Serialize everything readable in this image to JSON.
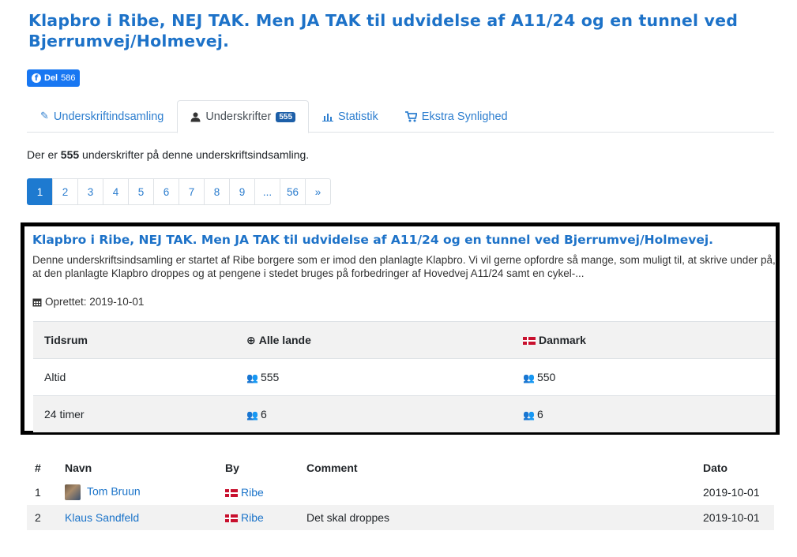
{
  "title": "Klapbro i Ribe, NEJ TAK. Men JA TAK til udvidelse af A11/24 og en tunnel ved Bjerrumvej/Holmevej.",
  "share": {
    "icon": "facebook-icon",
    "label": "Del",
    "count": "586"
  },
  "tabs": [
    {
      "label": "Underskriftindsamling",
      "icon": "pencil-icon"
    },
    {
      "label": "Underskrifter",
      "icon": "user-icon",
      "badge": "555"
    },
    {
      "label": "Statistik",
      "icon": "bar-chart-icon"
    },
    {
      "label": "Ekstra Synlighed",
      "icon": "cart-icon"
    }
  ],
  "summary": {
    "prefix": "Der er",
    "count": "555",
    "suffix": "underskrifter på denne underskriftsindsamling."
  },
  "pagination": [
    "1",
    "2",
    "3",
    "4",
    "5",
    "6",
    "7",
    "8",
    "9",
    "...",
    "56",
    "»"
  ],
  "card": {
    "title": "Klapbro i Ribe, NEJ TAK. Men JA TAK til udvidelse af A11/24 og en tunnel ved Bjerrumvej/Holmevej.",
    "description": "Denne underskriftsindsamling er startet af Ribe borgere som er imod den planlagte Klapbro. Vi vil gerne opfordre så mange, som muligt til, at skrive under på, at den planlagte Klapbro droppes og at pengene i stedet bruges på forbedringer af Hovedvej A11/24 samt en cykel-...",
    "created_label": "Oprettet: 2019-10-01",
    "stats": {
      "headers": [
        "Tidsrum",
        "Alle lande",
        "Danmark"
      ],
      "rows": [
        {
          "period": "Altid",
          "all": "555",
          "dk": "550"
        },
        {
          "period": "24 timer",
          "all": "6",
          "dk": "6"
        }
      ]
    }
  },
  "signatures": {
    "headers": [
      "#",
      "Navn",
      "By",
      "Comment",
      "Dato"
    ],
    "rows": [
      {
        "num": "1",
        "name": "Tom Bruun",
        "city": "Ribe",
        "comment": "",
        "date": "2019-10-01"
      },
      {
        "num": "2",
        "name": "Klaus Sandfeld",
        "city": "Ribe",
        "comment": "Det skal droppes",
        "date": "2019-10-01"
      }
    ]
  }
}
